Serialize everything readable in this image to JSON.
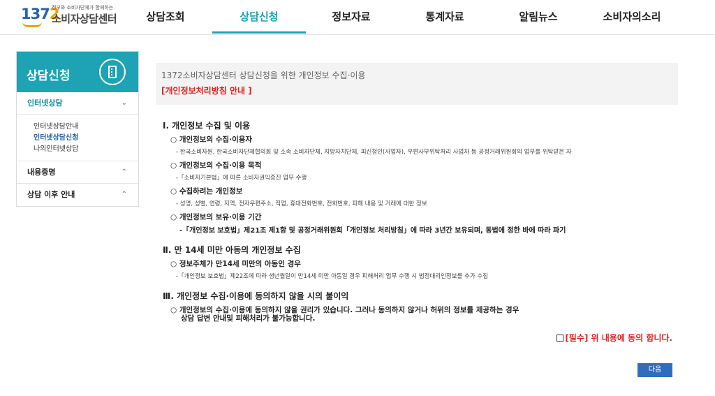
{
  "logo": {
    "number_main": "137",
    "number_accent": "2",
    "tagline": "정부와 소비자단체가 함께하는",
    "name": "소비자상담센터"
  },
  "nav": {
    "items": [
      "상담조회",
      "상담신청",
      "정보자료",
      "통계자료",
      "알림뉴스",
      "소비자의소리"
    ],
    "active_index": 1
  },
  "sidebar": {
    "title": "상담신청",
    "sections": [
      {
        "label": "인터넷상담",
        "chevron": "⌄",
        "sub": [
          "인터넷상담안내",
          "인터넷상담신청",
          "나의인터넷상담"
        ]
      },
      {
        "label": "내용증명",
        "chevron": "⌃"
      },
      {
        "label": "상담 이후 안내",
        "chevron": "⌃"
      }
    ]
  },
  "intro": {
    "title": "1372소비자상담센터 상담신청을 위한 개인정보 수집·이용",
    "link": "[개인정보처리방침 안내 ]"
  },
  "content": {
    "s1": "Ⅰ. 개인정보 수집 및 이용",
    "s1_i1": "○ 개인정보의 수집·이용자",
    "s1_d1": "- 한국소비자원, 한국소비자단체협의회 및 소속 소비자단체, 지방자치단체, 피신청인(사업자), 우편사무위탁처리 사업자 등 공정거래위원회의 업무를 위탁받은 자",
    "s1_i2": "○ 개인정보의 수집·이용 목적",
    "s1_d2": "-「소비자기본법」에 따른 소비자권익증진 업무 수행",
    "s1_i3": "○ 수집하려는 개인정보",
    "s1_d3": "- 성명, 성별, 연령, 지역, 전자우편주소, 직업, 휴대전화번호, 전화번호, 피해 내용 및 거래에 대한 정보",
    "s1_i4": "○ 개인정보의 보유·이용 기간",
    "s1_d4": "-「개인정보 보호법」제21조 제1항 및 공정거래위원회「개인정보 처리방침」에 따라 3년간 보유되며, 동법에 정한 바에 따라 파기",
    "s2": "Ⅱ. 만 14세 미만 아동의 개인정보 수집",
    "s2_i1": "○ 정보주체가 만14세 미만의 아동인 경우",
    "s2_d1": "-「개인정보 보호법」제22조에 따라 생년월일이 만14세 미만 아동일 경우 피해처리 업무 수행 시 법정대리인정보를 추가 수집",
    "s3": "Ⅲ. 개인정보 수집·이용에 동의하지 않을 시의 불이익",
    "s3_i1a": "○ 개인정보의 수집·이용에 동의하지 않을 권리가 있습니다. 그러나 동의하지 않거나 허위의 정보를 제공하는 경우",
    "s3_i1b": "상담 답변 안내및 피해처리가 불가능합니다."
  },
  "consent": {
    "label": "[필수] 위 내용에 동의 합니다."
  },
  "buttons": {
    "next": "다음"
  }
}
